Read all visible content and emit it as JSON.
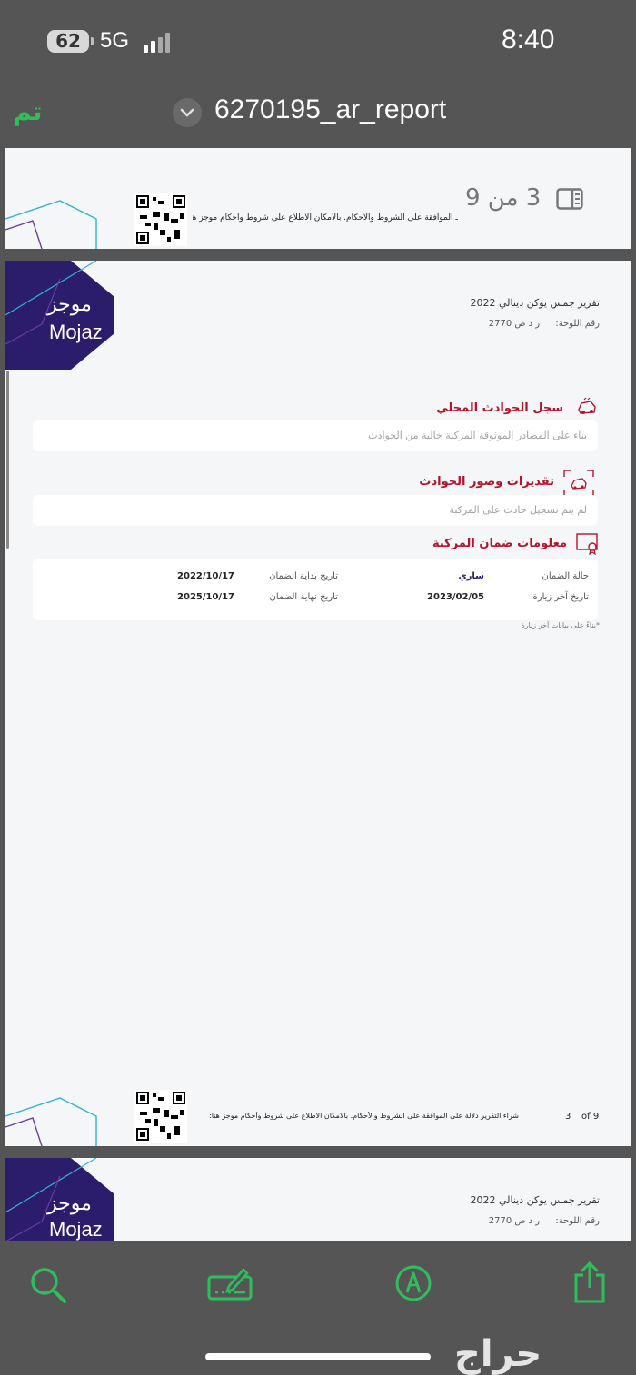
{
  "status_bar": {
    "battery": "62",
    "network": "5G",
    "time": "8:40"
  },
  "nav": {
    "done_label": "تم",
    "title": "6270195_ar_report"
  },
  "page_prev": {
    "terms_text": "ـ الموافقة على الشروط والأحكام. بالامكان الاطلاع على شروط وأحكام موجز هنا:",
    "page_indicator": "3 من 9"
  },
  "page_main": {
    "logo_ar": "موجز",
    "logo_en": "Mojaz",
    "report_title": "تقرير جمس يوكن دينالي 2022",
    "plate_label": "رقم اللوحة:",
    "plate_value": "ر د ص 2770",
    "sections": {
      "local_accidents": {
        "title": "سجل الحوادث المحلي",
        "text": "بناء على المصادر الموثوقة المركبة خالية من الحوادث"
      },
      "accident_estimates": {
        "title": "تقديرات وصور الحوادث",
        "text": "لم يتم تسجيل حادث على المركبة"
      },
      "warranty": {
        "title": "معلومات ضمان المركبة",
        "status_label": "حالة الضمان",
        "status_value": "ساري",
        "last_visit_label": "تاريخ آخر زيارة",
        "last_visit_value": "2023/02/05",
        "start_label": "تاريخ بداية الضمان",
        "start_value": "2022/10/17",
        "end_label": "تاريخ نهاية الضمان",
        "end_value": "2025/10/17",
        "footnote": "*بناءً على بيانات آخر زيارة"
      }
    },
    "footer_terms": "شراء التقرير دلالة على الموافقة على الشروط والأحكام. بالامكان الاطلاع على شروط وأحكام موجز هنا:",
    "footer_page_num": "3",
    "footer_page_of": "of 9"
  },
  "page_next": {
    "logo_ar": "موجز",
    "logo_en": "Mojaz",
    "report_title": "تقرير جمس يوكن دينالي 2022",
    "plate_label": "رقم اللوحة:",
    "plate_value": "ر د ص 2770"
  },
  "toolbar": {
    "icons": [
      "search-icon",
      "markup-icon",
      "pen-icon",
      "share-icon"
    ]
  },
  "watermark": "حراج",
  "colors": {
    "accent_green": "#2ebf5c",
    "brand_purple": "#2b1d6b",
    "section_red": "#b3152a",
    "background": "#555555"
  }
}
